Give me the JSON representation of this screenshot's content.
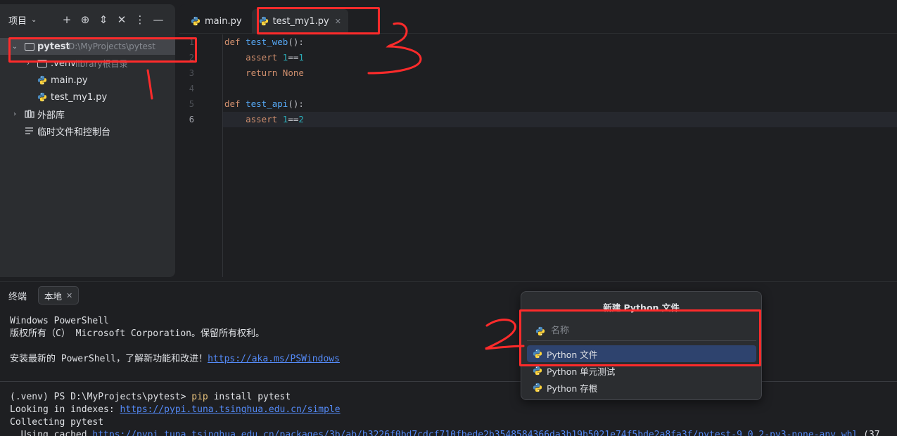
{
  "project_panel": {
    "title": "项目",
    "tree": {
      "root_name": "pytest",
      "root_path": "D:\\MyProjects\\pytest",
      "venv_name": ".venv",
      "venv_hint": "library根目录",
      "files": [
        "main.py",
        "test_my1.py"
      ],
      "external_libs": "外部库",
      "scratches": "临时文件和控制台"
    }
  },
  "editor": {
    "tabs": [
      {
        "label": "main.py",
        "active": false
      },
      {
        "label": "test_my1.py",
        "active": true
      }
    ],
    "line_numbers": [
      "1",
      "2",
      "3",
      "4",
      "5",
      "6"
    ],
    "current_line": 6
  },
  "terminal": {
    "title": "终端",
    "tab_label": "本地",
    "lines": {
      "l1": "Windows PowerShell",
      "l2": "版权所有（C） Microsoft Corporation。保留所有权利。",
      "l3_text": "安装最新的 PowerShell，了解新功能和改进！",
      "l3_link": "https://aka.ms/PSWindows",
      "prompt": "(.venv) PS D:\\MyProjects\\pytest> ",
      "cmd_pip": "pip",
      "cmd_rest": " install pytest",
      "l5_text": "Looking in indexes: ",
      "l5_link": "https://pypi.tuna.tsinghua.edu.cn/simple",
      "l6": "Collecting pytest",
      "l7_text": "  Using cached ",
      "l7_link": "https://pypi.tuna.tsinghua.edu.cn/packages/3b/ab/b3226f0bd7cdcf710fbede2b3548584366da3b19b5021e74f5bde2a8fa3f/pytest-9.0.2-py3-none-any.whl",
      "l7_tail": " (37"
    }
  },
  "popup": {
    "title": "新建 Python 文件",
    "input_placeholder": "名称",
    "items": [
      "Python 文件",
      "Python 单元测试",
      "Python 存根"
    ],
    "selected_index": 0
  },
  "colors": {
    "annotation_red": "#ff2b2b",
    "selection_blue": "#2e436e",
    "link_blue": "#548af7"
  }
}
